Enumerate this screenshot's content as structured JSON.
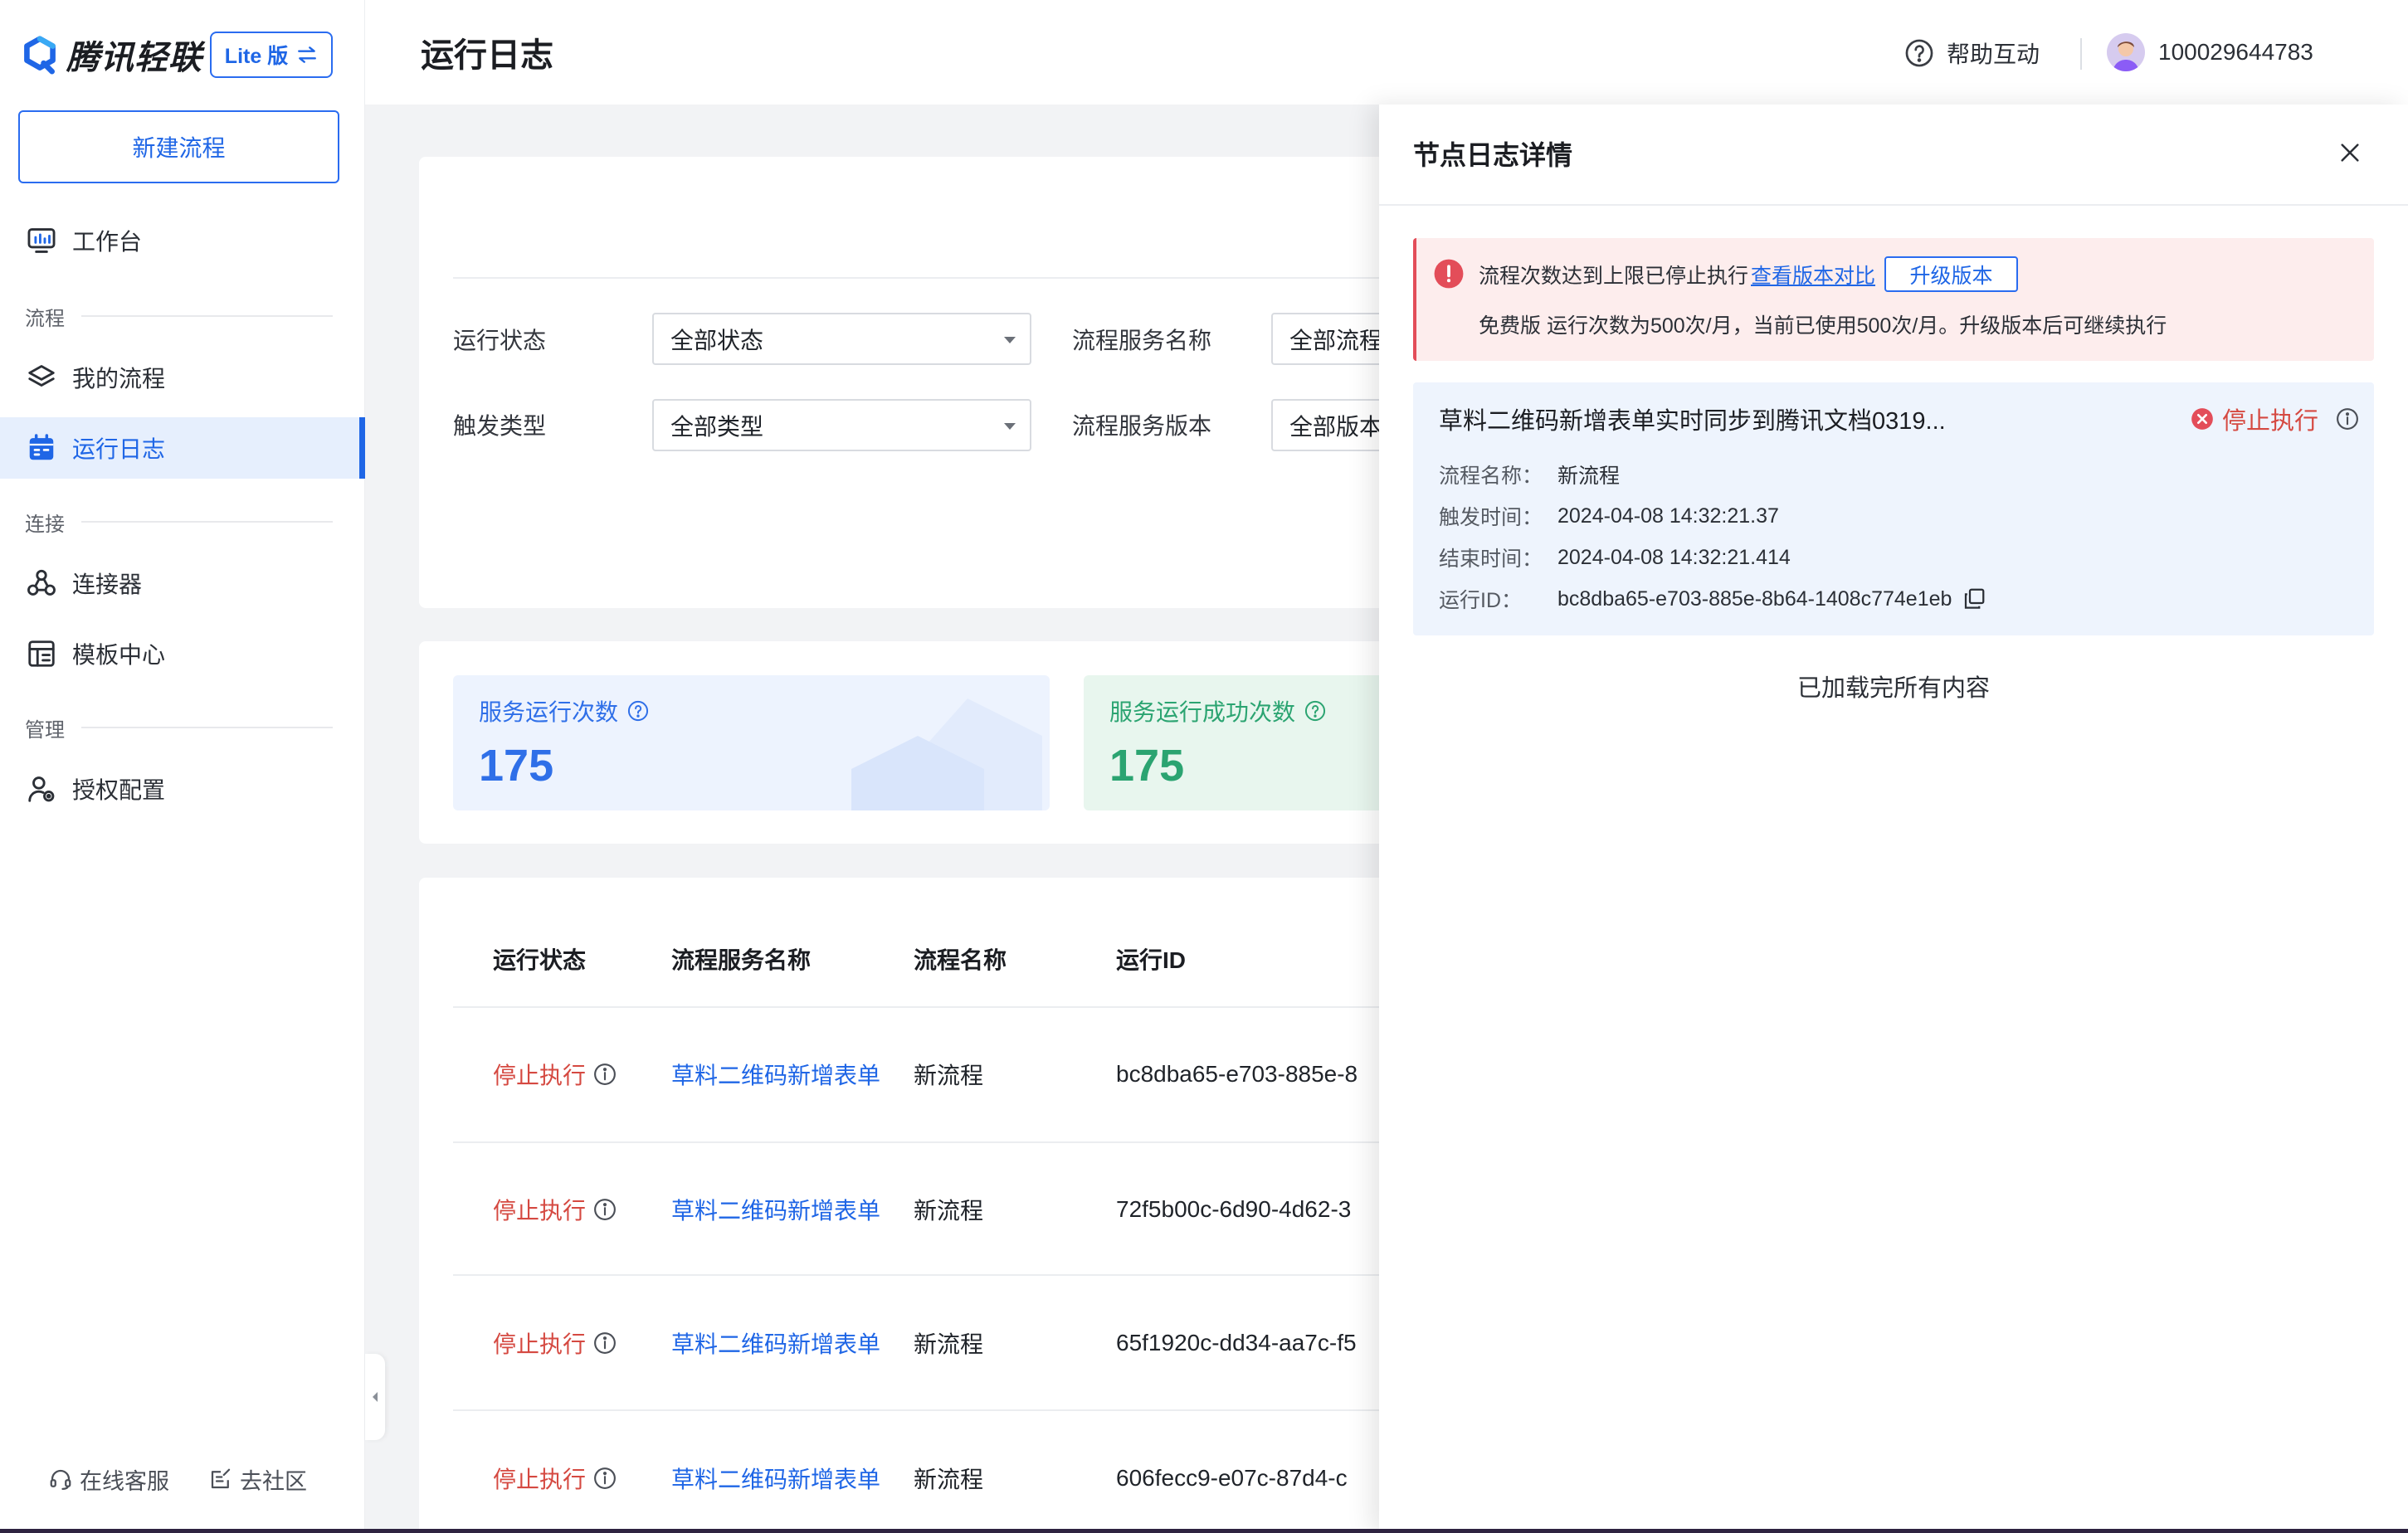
{
  "app": {
    "logo_text": "腾讯轻联",
    "edition_label": "Lite 版",
    "logo_icon": "tencent-qinglian-logo",
    "brand_color": "#1f66e6"
  },
  "header": {
    "title": "运行日志",
    "help_label": "帮助互动",
    "help_icon": "help-circle-icon",
    "user_id": "100029644783"
  },
  "sidebar": {
    "new_flow_label": "新建流程",
    "workbench": {
      "label": "工作台",
      "icon": "dashboard-icon"
    },
    "sections": [
      {
        "title": "流程",
        "items": [
          {
            "label": "我的流程",
            "icon": "layers-icon"
          },
          {
            "label": "运行日志",
            "icon": "calendar-icon",
            "active": true
          }
        ]
      },
      {
        "title": "连接",
        "items": [
          {
            "label": "连接器",
            "icon": "connector-icon"
          },
          {
            "label": "模板中心",
            "icon": "template-icon"
          }
        ]
      },
      {
        "title": "管理",
        "items": [
          {
            "label": "授权配置",
            "icon": "user-settings-icon"
          }
        ]
      }
    ],
    "footer": {
      "support_label": "在线客服",
      "community_label": "去社区"
    }
  },
  "filters": {
    "run_status": {
      "label": "运行状态",
      "value": "全部状态"
    },
    "service_name": {
      "label": "流程服务名称",
      "value": "全部流程"
    },
    "trigger_type": {
      "label": "触发类型",
      "value": "全部类型"
    },
    "service_version": {
      "label": "流程服务版本",
      "value": "全部版本"
    }
  },
  "stats": [
    {
      "label": "服务运行次数",
      "value": "175",
      "color": "#2f6fe8"
    },
    {
      "label": "服务运行成功次数",
      "value": "175",
      "color": "#2ba471"
    }
  ],
  "table": {
    "columns": [
      "运行状态",
      "流程服务名称",
      "流程名称",
      "运行ID"
    ],
    "rows": [
      {
        "status": "停止执行",
        "service_name": "草料二维码新增表单",
        "flow_name": "新流程",
        "run_id": "bc8dba65-e703-885e-8"
      },
      {
        "status": "停止执行",
        "service_name": "草料二维码新增表单",
        "flow_name": "新流程",
        "run_id": "72f5b00c-6d90-4d62-3"
      },
      {
        "status": "停止执行",
        "service_name": "草料二维码新增表单",
        "flow_name": "新流程",
        "run_id": "65f1920c-dd34-aa7c-f5"
      },
      {
        "status": "停止执行",
        "service_name": "草料二维码新增表单",
        "flow_name": "新流程",
        "run_id": "606fecc9-e07c-87d4-c"
      }
    ],
    "status_color": "#d54941"
  },
  "drawer": {
    "title": "节点日志详情",
    "alert": {
      "message": "流程次数达到上限已停止执行",
      "compare_link": "查看版本对比",
      "upgrade_button": "升级版本",
      "detail": "免费版 运行次数为500次/月，当前已使用500次/月。升级版本后可继续执行"
    },
    "run": {
      "title": "草料二维码新增表单实时同步到腾讯文档0319...",
      "status": "停止执行",
      "fields": [
        {
          "key": "流程名称：",
          "value": "新流程"
        },
        {
          "key": "触发时间：",
          "value": "2024-04-08 14:32:21.37"
        },
        {
          "key": "结束时间：",
          "value": "2024-04-08 14:32:21.414"
        },
        {
          "key": "运行ID：",
          "value": "bc8dba65-e703-885e-8b64-1408c774e1eb"
        }
      ]
    },
    "end_text": "已加载完所有内容"
  }
}
